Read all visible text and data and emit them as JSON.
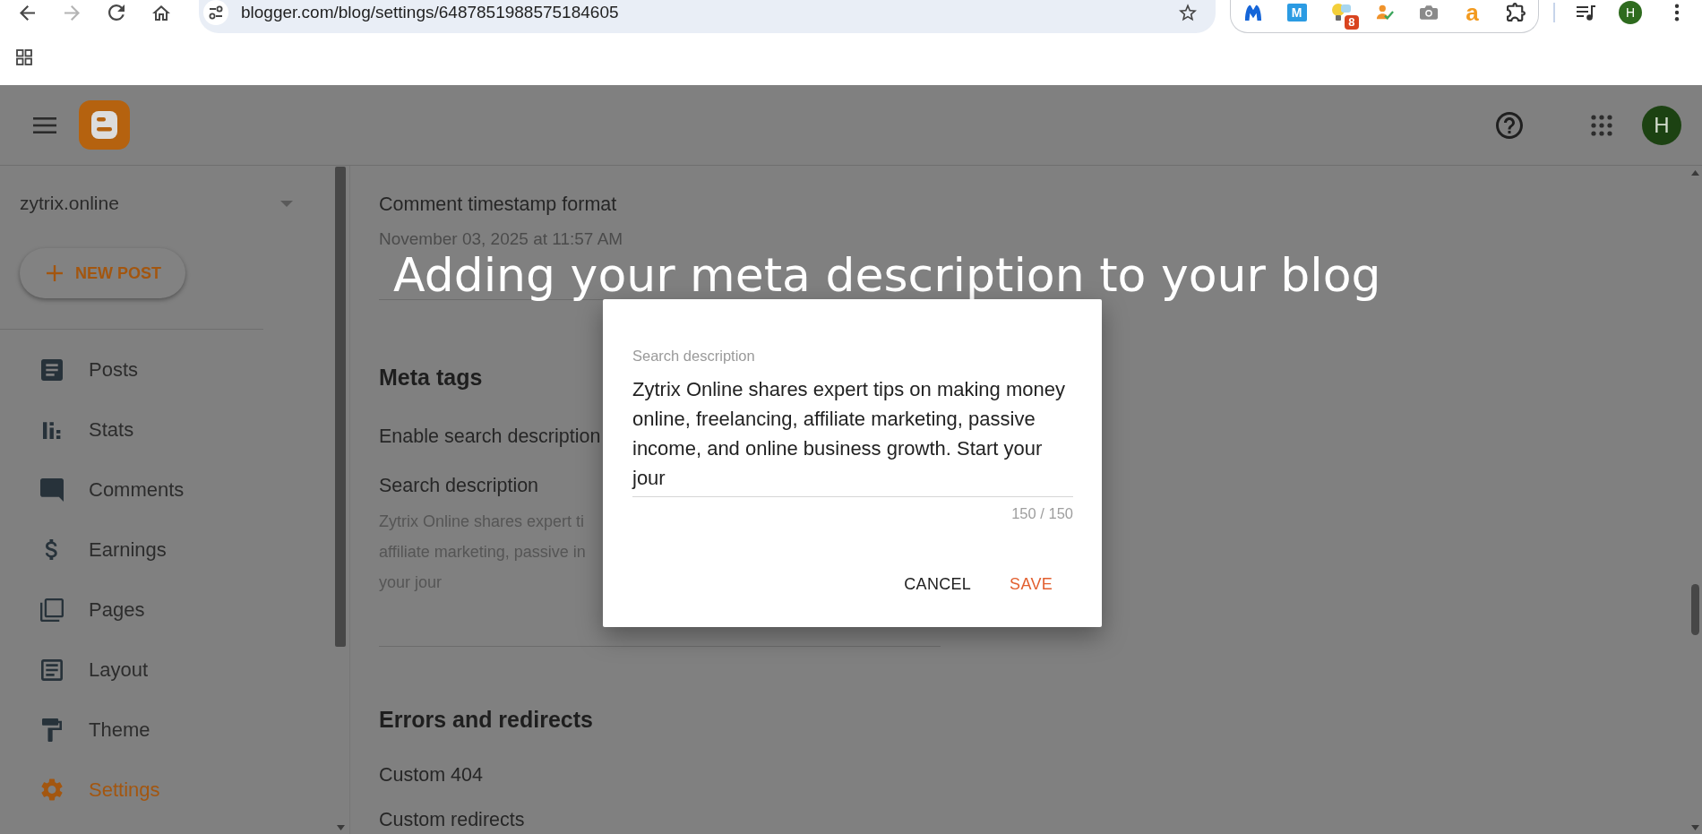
{
  "browser": {
    "nav": [
      {
        "kind": "back",
        "disabled": false
      },
      {
        "kind": "forward",
        "disabled": true
      },
      {
        "kind": "reload",
        "disabled": false
      },
      {
        "kind": "home",
        "disabled": false
      }
    ],
    "url": "blogger.com/blog/settings/6487851988575184605",
    "extensions": [
      {
        "kind": "claw"
      },
      {
        "kind": "tile",
        "text": "M"
      },
      {
        "kind": "bulb",
        "badge": "8"
      },
      {
        "kind": "person"
      },
      {
        "kind": "camera"
      },
      {
        "kind": "letter",
        "text": "a"
      },
      {
        "kind": "puzzle"
      }
    ],
    "profile_initial": "H"
  },
  "app_bar": {
    "avatar_initial": "H"
  },
  "sidebar": {
    "blog_name": "zytrix.online",
    "new_post_label": "NEW POST",
    "items": [
      {
        "label": "Posts",
        "kind": "posts",
        "selected": false
      },
      {
        "label": "Stats",
        "kind": "stats",
        "selected": false
      },
      {
        "label": "Comments",
        "kind": "comments",
        "selected": false
      },
      {
        "label": "Earnings",
        "kind": "earnings",
        "selected": false
      },
      {
        "label": "Pages",
        "kind": "pages",
        "selected": false
      },
      {
        "label": "Layout",
        "kind": "layout",
        "selected": false
      },
      {
        "label": "Theme",
        "kind": "theme",
        "selected": false
      },
      {
        "label": "Settings",
        "kind": "settings",
        "selected": true
      }
    ]
  },
  "settings": {
    "sections": [
      {
        "rows": [
          {
            "title": "Comment timestamp format",
            "value": "November 03, 2025 at 11:57 AM"
          }
        ]
      },
      {
        "heading": "Meta tags",
        "rows": [
          {
            "title": "Enable search description"
          },
          {
            "title": "Search description",
            "value_lines": [
              "Zytrix Online shares expert ti",
              "affiliate marketing, passive in",
              "your jour"
            ]
          }
        ]
      },
      {
        "heading": "Errors and redirects",
        "rows": [
          {
            "title": "Custom 404"
          },
          {
            "title": "Custom redirects"
          }
        ]
      }
    ]
  },
  "dialog": {
    "field_label": "Search description",
    "value": "Zytrix Online shares expert tips on making money online, freelancing, affiliate marketing, passive income, and online business growth. Start your jour",
    "counter": "150 / 150",
    "buttons": [
      {
        "label": "CANCEL",
        "kind": "cancel"
      },
      {
        "label": "SAVE",
        "kind": "confirm"
      }
    ]
  },
  "caption": "Adding your meta description to your blog"
}
